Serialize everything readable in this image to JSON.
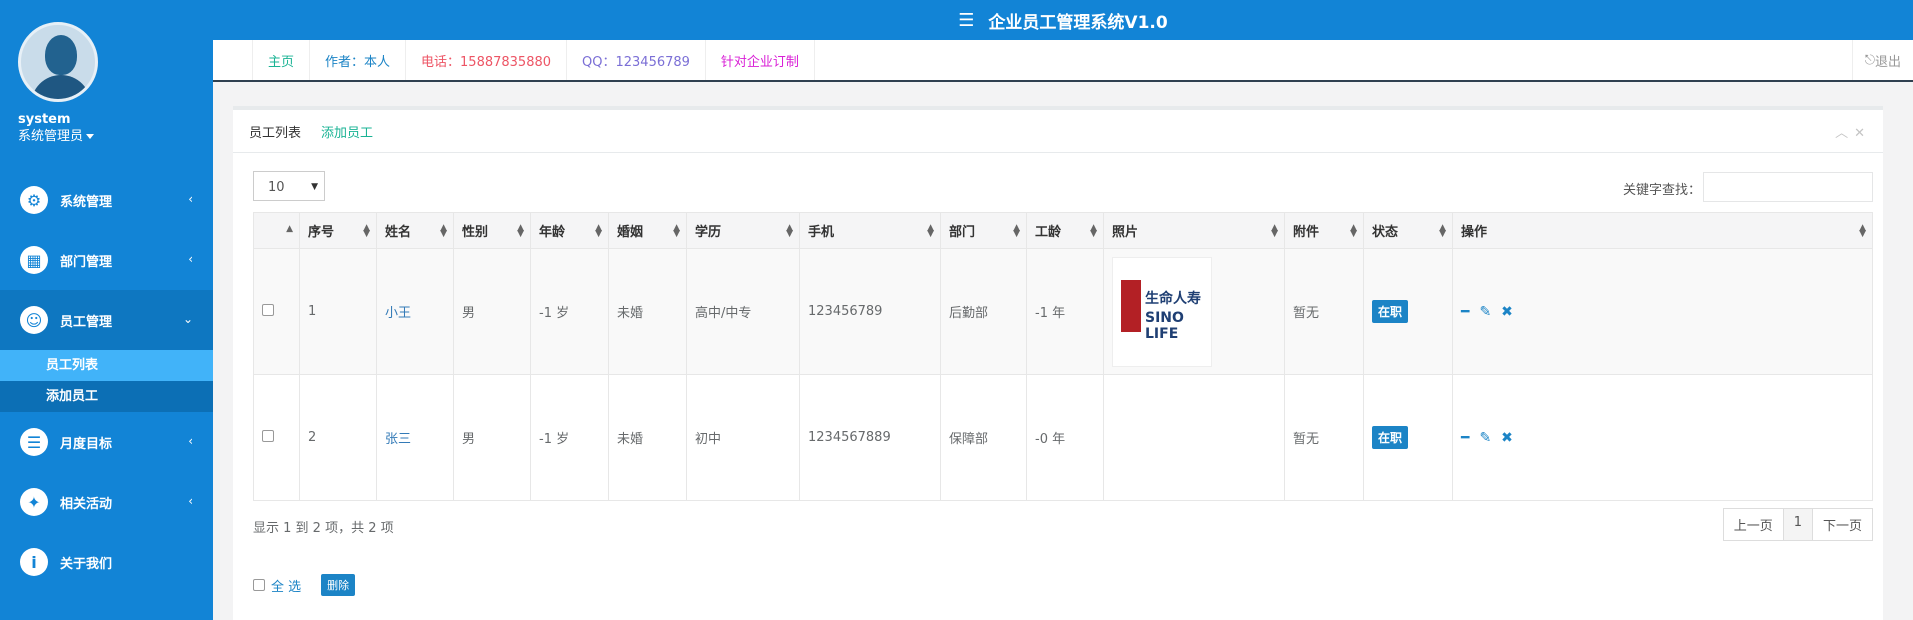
{
  "app": {
    "title": "企业员工管理系统V1.0"
  },
  "user": {
    "name": "system",
    "role": "系统管理员"
  },
  "sidebar": {
    "items": [
      {
        "label": "系统管理",
        "icon": "gear-icon"
      },
      {
        "label": "部门管理",
        "icon": "grid-icon"
      },
      {
        "label": "员工管理",
        "icon": "users-icon"
      },
      {
        "label": "月度目标",
        "icon": "list-icon"
      },
      {
        "label": "相关活动",
        "icon": "activity-icon"
      },
      {
        "label": "关于我们",
        "icon": "info-icon"
      }
    ],
    "sub_items": [
      "员工列表",
      "添加员工"
    ]
  },
  "tabs": [
    {
      "label": "主页",
      "color": "#1ab394"
    },
    {
      "label": "作者：本人",
      "color": "#1c84c6"
    },
    {
      "label": "电话：15887835880",
      "color": "#ed5565"
    },
    {
      "label": "QQ：123456789",
      "color": "#7b6fd6"
    },
    {
      "label": "针对企业订制",
      "color": "#d91fd6"
    }
  ],
  "logout": "退出",
  "panel": {
    "title": "员工列表",
    "add_link": "添加员工",
    "page_size": "10",
    "search_label": "关键字查找："
  },
  "table": {
    "headers": [
      "序号",
      "姓名",
      "性别",
      "年龄",
      "婚姻",
      "学历",
      "手机",
      "部门",
      "工龄",
      "照片",
      "附件",
      "状态",
      "操作"
    ],
    "rows": [
      {
        "id": "1",
        "name": "小王",
        "gender": "男",
        "age": "-1 岁",
        "marriage": "未婚",
        "education": "高中/中专",
        "phone": "123456789",
        "dept": "后勤部",
        "tenure": "-1 年",
        "photo_cn": "生命人寿",
        "photo_en": "SINO LIFE",
        "attachment": "暂无",
        "status": "在职"
      },
      {
        "id": "2",
        "name": "张三",
        "gender": "男",
        "age": "-1 岁",
        "marriage": "未婚",
        "education": "初中",
        "phone": "1234567889",
        "dept": "保障部",
        "tenure": "-0 年",
        "photo_cn": "",
        "photo_en": "",
        "attachment": "暂无",
        "status": "在职"
      }
    ]
  },
  "footer": {
    "info": "显示 1 到 2 项，共 2 项",
    "prev": "上一页",
    "page": "1",
    "next": "下一页",
    "select_all": "全 选",
    "delete": "删除"
  }
}
